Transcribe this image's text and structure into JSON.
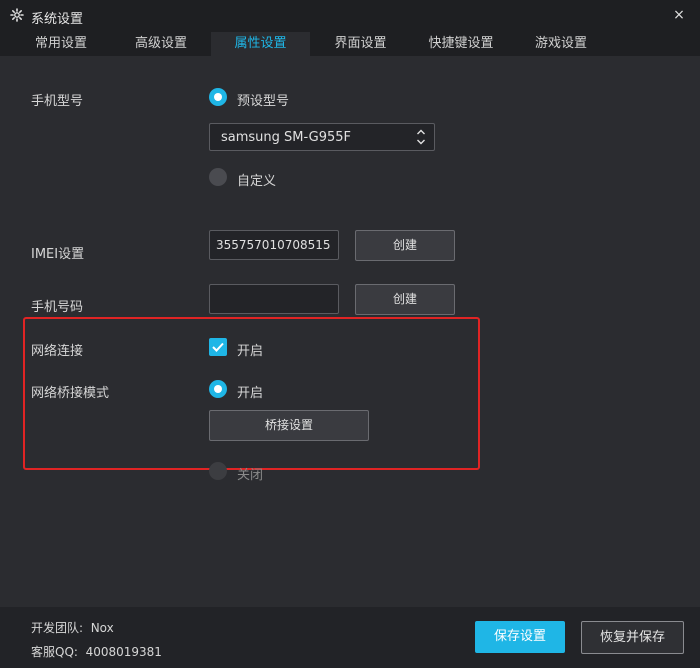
{
  "window": {
    "title": "系统设置",
    "icon": "gear-icon",
    "close": "×"
  },
  "tabs": [
    {
      "label": "常用设置",
      "active": false
    },
    {
      "label": "高级设置",
      "active": false
    },
    {
      "label": "属性设置",
      "active": true
    },
    {
      "label": "界面设置",
      "active": false
    },
    {
      "label": "快捷键设置",
      "active": false
    },
    {
      "label": "游戏设置",
      "active": false
    }
  ],
  "phone_model": {
    "label": "手机型号",
    "preset_label": "预设型号",
    "preset_selected": true,
    "select_value": "samsung SM-G955F",
    "custom_label": "自定义",
    "custom_selected": false
  },
  "imei": {
    "label": "IMEI设置",
    "value": "355757010708515",
    "button": "创建"
  },
  "phone_number": {
    "label": "手机号码",
    "value": "",
    "button": "创建"
  },
  "network": {
    "label": "网络连接",
    "checked": true,
    "option_label": "开启"
  },
  "bridge": {
    "label": "网络桥接模式",
    "on_label": "开启",
    "on_selected": true,
    "settings_button": "桥接设置",
    "off_label": "关闭",
    "off_selected": false
  },
  "footer": {
    "team_label": "开发团队:",
    "team_value": "Nox",
    "qq_label": "客服QQ:",
    "qq_value": "4008019381",
    "save_button": "保存设置",
    "restore_button": "恢复并保存"
  },
  "colors": {
    "accent": "#1fb6e6",
    "background": "#2b2c30",
    "titlebar": "#1e1f22",
    "highlight": "#e02424"
  }
}
